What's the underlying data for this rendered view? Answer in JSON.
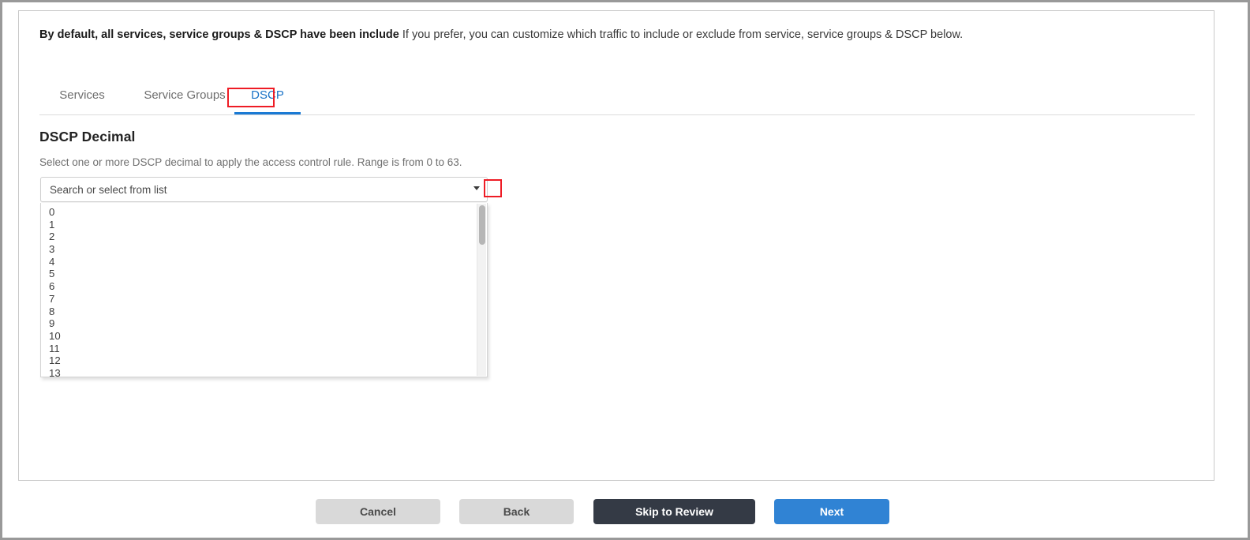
{
  "intro": {
    "bold_text": "By default, all services, service groups & DSCP have been include",
    "normal_text": " If you prefer, you can customize which traffic to include or exclude from service, service groups & DSCP below."
  },
  "tabs": {
    "items": [
      {
        "id": "services",
        "label": "Services",
        "active": false
      },
      {
        "id": "service-groups",
        "label": "Service Groups",
        "active": false
      },
      {
        "id": "dscp",
        "label": "DSCP",
        "active": true
      }
    ],
    "active_tab": "DSCP"
  },
  "section": {
    "title": "DSCP Decimal",
    "description": "Select one or more DSCP decimal to apply the access control rule. Range is from 0 to 63."
  },
  "combobox": {
    "placeholder": "Search or select from list",
    "value": "",
    "caret_icon": "chevron-down-icon",
    "expanded": true
  },
  "dropdown": {
    "visible_options": [
      "0",
      "1",
      "2",
      "3",
      "4",
      "5",
      "6",
      "7",
      "8",
      "9",
      "10",
      "11",
      "12",
      "13"
    ],
    "range_min": "0",
    "range_max": "63",
    "scroll_position": "top"
  },
  "footer": {
    "buttons": [
      {
        "id": "cancel",
        "label": "Cancel"
      },
      {
        "id": "back",
        "label": "Back"
      },
      {
        "id": "skip",
        "label": "Skip to Review"
      },
      {
        "id": "next",
        "label": "Next"
      }
    ]
  },
  "annotations": {
    "color": "#ee1c25",
    "boxes": [
      "dscp-tab-highlight",
      "dropdown-caret-highlight"
    ]
  },
  "colors": {
    "accent_blue": "#1a7ad4",
    "primary_button": "#3083d4",
    "dark_button": "#343a45",
    "annotation_red": "#ee1c25"
  }
}
